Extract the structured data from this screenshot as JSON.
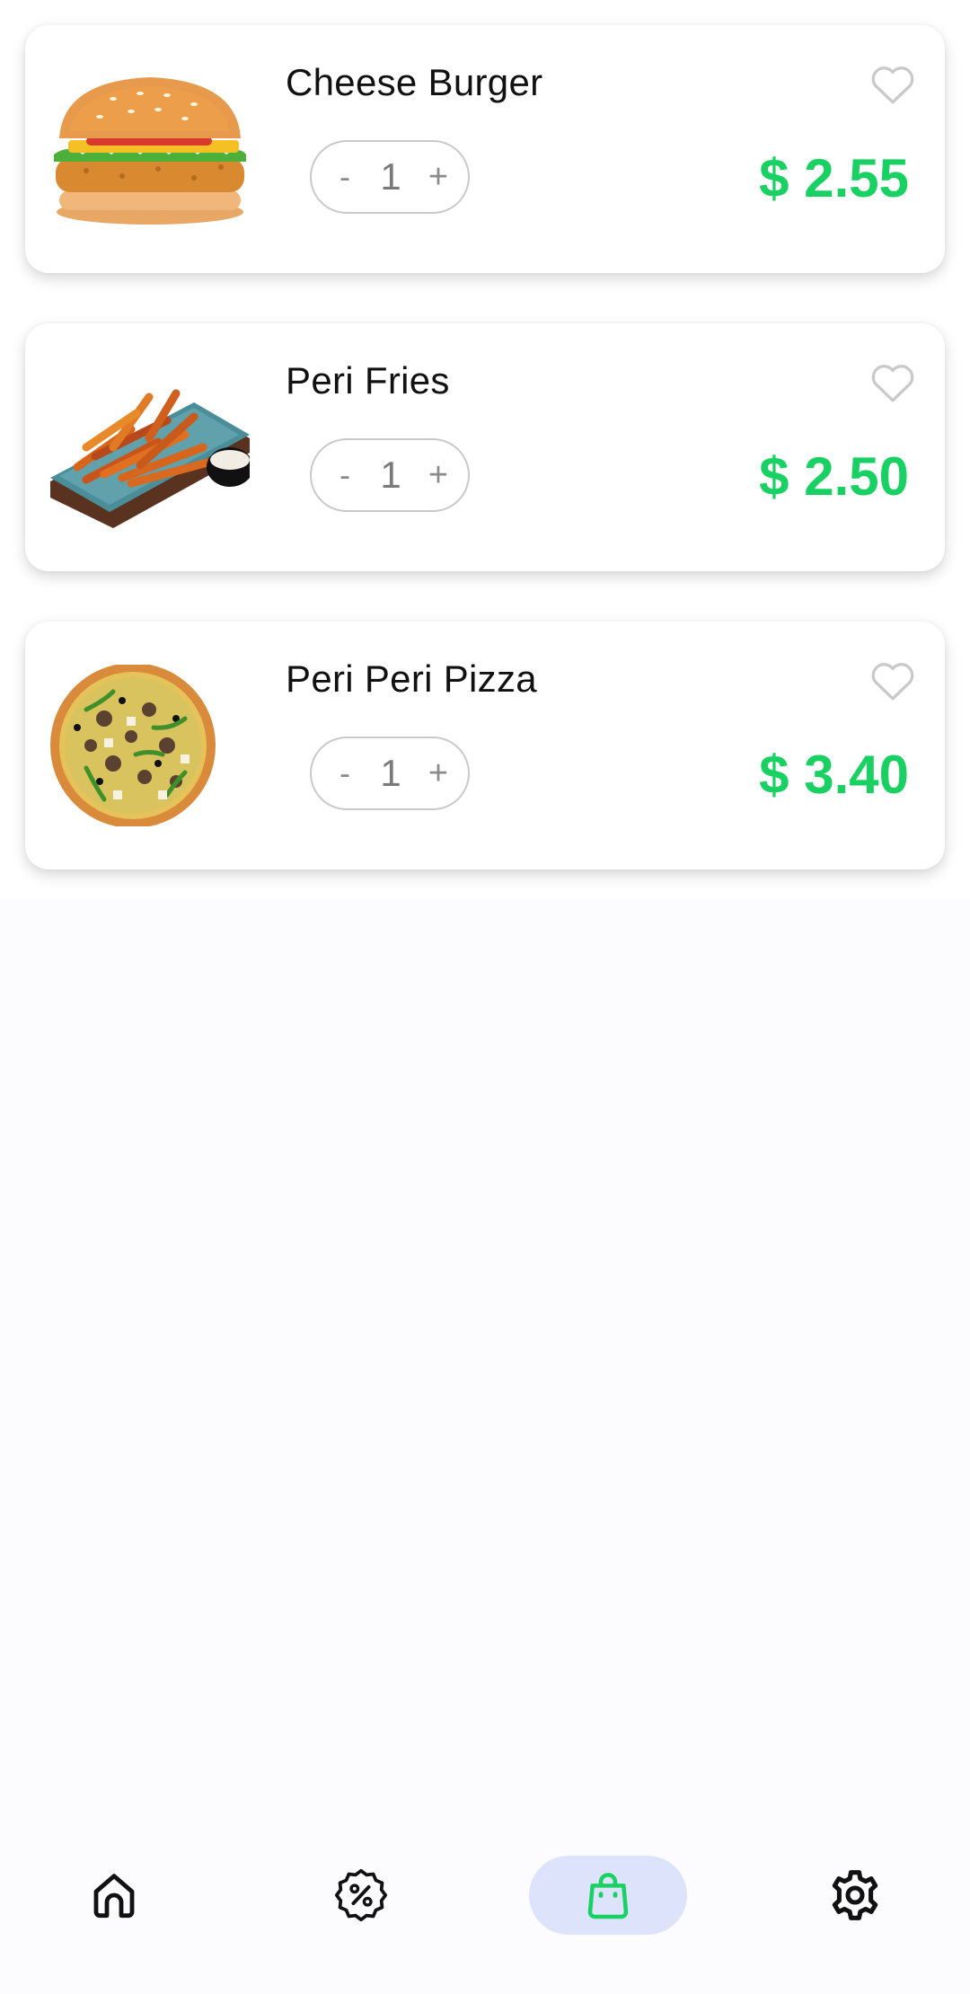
{
  "cart": {
    "items": [
      {
        "name": "Cheese Burger",
        "quantity": "1",
        "price": "$ 2.55",
        "image": "cheese-burger-image",
        "favorite": false
      },
      {
        "name": "Peri Fries",
        "quantity": "1",
        "price": "$ 2.50",
        "image": "peri-fries-image",
        "favorite": false
      },
      {
        "name": "Peri Peri Pizza",
        "quantity": "1",
        "price": "$ 3.40",
        "image": "peri-peri-pizza-image",
        "favorite": false
      }
    ],
    "decrement_label": "-",
    "increment_label": "+"
  },
  "bottom_nav": {
    "items": [
      {
        "icon": "home-icon",
        "active": false
      },
      {
        "icon": "discount-icon",
        "active": false
      },
      {
        "icon": "shopping-bag-icon",
        "active": true
      },
      {
        "icon": "settings-icon",
        "active": false
      }
    ]
  },
  "colors": {
    "price": "#19d163",
    "active_nav_bg": "#dde3fb",
    "active_nav_icon": "#19d163",
    "heart_outline": "#c9c9c9"
  }
}
